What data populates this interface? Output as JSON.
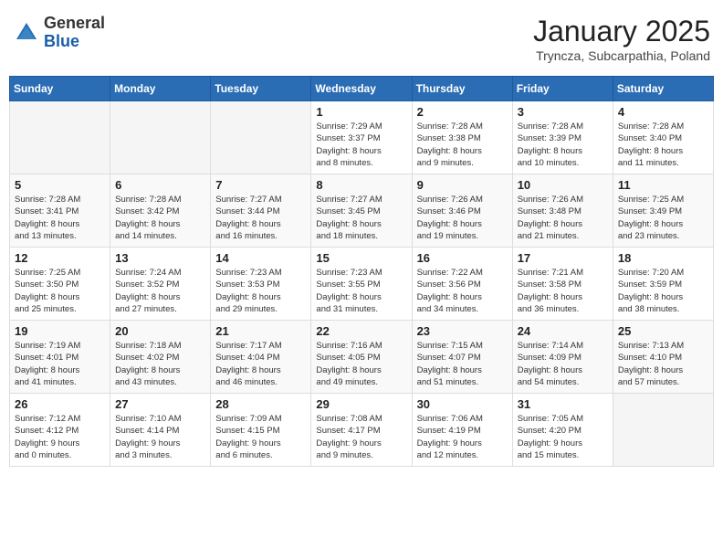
{
  "header": {
    "logo_general": "General",
    "logo_blue": "Blue",
    "month_title": "January 2025",
    "location": "Tryncza, Subcarpathia, Poland"
  },
  "weekdays": [
    "Sunday",
    "Monday",
    "Tuesday",
    "Wednesday",
    "Thursday",
    "Friday",
    "Saturday"
  ],
  "weeks": [
    [
      {
        "day": "",
        "info": ""
      },
      {
        "day": "",
        "info": ""
      },
      {
        "day": "",
        "info": ""
      },
      {
        "day": "1",
        "info": "Sunrise: 7:29 AM\nSunset: 3:37 PM\nDaylight: 8 hours\nand 8 minutes."
      },
      {
        "day": "2",
        "info": "Sunrise: 7:28 AM\nSunset: 3:38 PM\nDaylight: 8 hours\nand 9 minutes."
      },
      {
        "day": "3",
        "info": "Sunrise: 7:28 AM\nSunset: 3:39 PM\nDaylight: 8 hours\nand 10 minutes."
      },
      {
        "day": "4",
        "info": "Sunrise: 7:28 AM\nSunset: 3:40 PM\nDaylight: 8 hours\nand 11 minutes."
      }
    ],
    [
      {
        "day": "5",
        "info": "Sunrise: 7:28 AM\nSunset: 3:41 PM\nDaylight: 8 hours\nand 13 minutes."
      },
      {
        "day": "6",
        "info": "Sunrise: 7:28 AM\nSunset: 3:42 PM\nDaylight: 8 hours\nand 14 minutes."
      },
      {
        "day": "7",
        "info": "Sunrise: 7:27 AM\nSunset: 3:44 PM\nDaylight: 8 hours\nand 16 minutes."
      },
      {
        "day": "8",
        "info": "Sunrise: 7:27 AM\nSunset: 3:45 PM\nDaylight: 8 hours\nand 18 minutes."
      },
      {
        "day": "9",
        "info": "Sunrise: 7:26 AM\nSunset: 3:46 PM\nDaylight: 8 hours\nand 19 minutes."
      },
      {
        "day": "10",
        "info": "Sunrise: 7:26 AM\nSunset: 3:48 PM\nDaylight: 8 hours\nand 21 minutes."
      },
      {
        "day": "11",
        "info": "Sunrise: 7:25 AM\nSunset: 3:49 PM\nDaylight: 8 hours\nand 23 minutes."
      }
    ],
    [
      {
        "day": "12",
        "info": "Sunrise: 7:25 AM\nSunset: 3:50 PM\nDaylight: 8 hours\nand 25 minutes."
      },
      {
        "day": "13",
        "info": "Sunrise: 7:24 AM\nSunset: 3:52 PM\nDaylight: 8 hours\nand 27 minutes."
      },
      {
        "day": "14",
        "info": "Sunrise: 7:23 AM\nSunset: 3:53 PM\nDaylight: 8 hours\nand 29 minutes."
      },
      {
        "day": "15",
        "info": "Sunrise: 7:23 AM\nSunset: 3:55 PM\nDaylight: 8 hours\nand 31 minutes."
      },
      {
        "day": "16",
        "info": "Sunrise: 7:22 AM\nSunset: 3:56 PM\nDaylight: 8 hours\nand 34 minutes."
      },
      {
        "day": "17",
        "info": "Sunrise: 7:21 AM\nSunset: 3:58 PM\nDaylight: 8 hours\nand 36 minutes."
      },
      {
        "day": "18",
        "info": "Sunrise: 7:20 AM\nSunset: 3:59 PM\nDaylight: 8 hours\nand 38 minutes."
      }
    ],
    [
      {
        "day": "19",
        "info": "Sunrise: 7:19 AM\nSunset: 4:01 PM\nDaylight: 8 hours\nand 41 minutes."
      },
      {
        "day": "20",
        "info": "Sunrise: 7:18 AM\nSunset: 4:02 PM\nDaylight: 8 hours\nand 43 minutes."
      },
      {
        "day": "21",
        "info": "Sunrise: 7:17 AM\nSunset: 4:04 PM\nDaylight: 8 hours\nand 46 minutes."
      },
      {
        "day": "22",
        "info": "Sunrise: 7:16 AM\nSunset: 4:05 PM\nDaylight: 8 hours\nand 49 minutes."
      },
      {
        "day": "23",
        "info": "Sunrise: 7:15 AM\nSunset: 4:07 PM\nDaylight: 8 hours\nand 51 minutes."
      },
      {
        "day": "24",
        "info": "Sunrise: 7:14 AM\nSunset: 4:09 PM\nDaylight: 8 hours\nand 54 minutes."
      },
      {
        "day": "25",
        "info": "Sunrise: 7:13 AM\nSunset: 4:10 PM\nDaylight: 8 hours\nand 57 minutes."
      }
    ],
    [
      {
        "day": "26",
        "info": "Sunrise: 7:12 AM\nSunset: 4:12 PM\nDaylight: 9 hours\nand 0 minutes."
      },
      {
        "day": "27",
        "info": "Sunrise: 7:10 AM\nSunset: 4:14 PM\nDaylight: 9 hours\nand 3 minutes."
      },
      {
        "day": "28",
        "info": "Sunrise: 7:09 AM\nSunset: 4:15 PM\nDaylight: 9 hours\nand 6 minutes."
      },
      {
        "day": "29",
        "info": "Sunrise: 7:08 AM\nSunset: 4:17 PM\nDaylight: 9 hours\nand 9 minutes."
      },
      {
        "day": "30",
        "info": "Sunrise: 7:06 AM\nSunset: 4:19 PM\nDaylight: 9 hours\nand 12 minutes."
      },
      {
        "day": "31",
        "info": "Sunrise: 7:05 AM\nSunset: 4:20 PM\nDaylight: 9 hours\nand 15 minutes."
      },
      {
        "day": "",
        "info": ""
      }
    ]
  ]
}
